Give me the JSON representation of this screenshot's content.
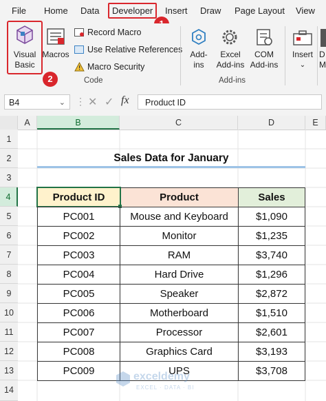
{
  "menu": {
    "tabs": [
      "File",
      "Home",
      "Data",
      "Developer",
      "Insert",
      "Draw",
      "Page Layout",
      "View"
    ]
  },
  "ribbon": {
    "code_group": {
      "visual_basic_line1": "Visual",
      "visual_basic_line2": "Basic",
      "macros": "Macros",
      "record_macro": "Record Macro",
      "use_relative": "Use Relative References",
      "macro_security": "Macro Security",
      "label": "Code"
    },
    "addins_group": {
      "addins_line1": "Add-",
      "addins_line2": "ins",
      "excel_addins_line1": "Excel",
      "excel_addins_line2": "Add-ins",
      "com_addins_line1": "COM",
      "com_addins_line2": "Add-ins",
      "label": "Add-ins"
    },
    "controls_group": {
      "insert": "Insert",
      "design_partial_line1": "D",
      "design_partial_line2": "M"
    },
    "annotations": [
      "1",
      "2"
    ]
  },
  "formula_bar": {
    "name_box": "B4",
    "fx": "fx",
    "content": "Product ID"
  },
  "sheet": {
    "columns": [
      "A",
      "B",
      "C",
      "D",
      "E"
    ],
    "rows": [
      "1",
      "2",
      "3",
      "4",
      "5",
      "6",
      "7",
      "8",
      "9",
      "10",
      "11",
      "12",
      "13",
      "14"
    ],
    "title": "Sales Data for January",
    "table": {
      "headers": [
        "Product ID",
        "Product",
        "Sales"
      ],
      "rows": [
        [
          "PC001",
          "Mouse and Keyboard",
          "$1,090"
        ],
        [
          "PC002",
          "Monitor",
          "$1,235"
        ],
        [
          "PC003",
          "RAM",
          "$3,740"
        ],
        [
          "PC004",
          "Hard Drive",
          "$1,296"
        ],
        [
          "PC005",
          "Speaker",
          "$2,872"
        ],
        [
          "PC006",
          "Motherboard",
          "$1,510"
        ],
        [
          "PC007",
          "Processor",
          "$2,601"
        ],
        [
          "PC008",
          "Graphics Card",
          "$3,193"
        ],
        [
          "PC009",
          "UPS",
          "$3,708"
        ]
      ]
    },
    "watermark": "exceldemy",
    "watermark_sub": "EXCEL · DATA · BI"
  },
  "colors": {
    "accent_red": "#d9262c",
    "excel_green": "#217346",
    "header_product_id": "#fff2cc",
    "header_product": "#fbe3d6",
    "header_sales": "#e2efda"
  }
}
